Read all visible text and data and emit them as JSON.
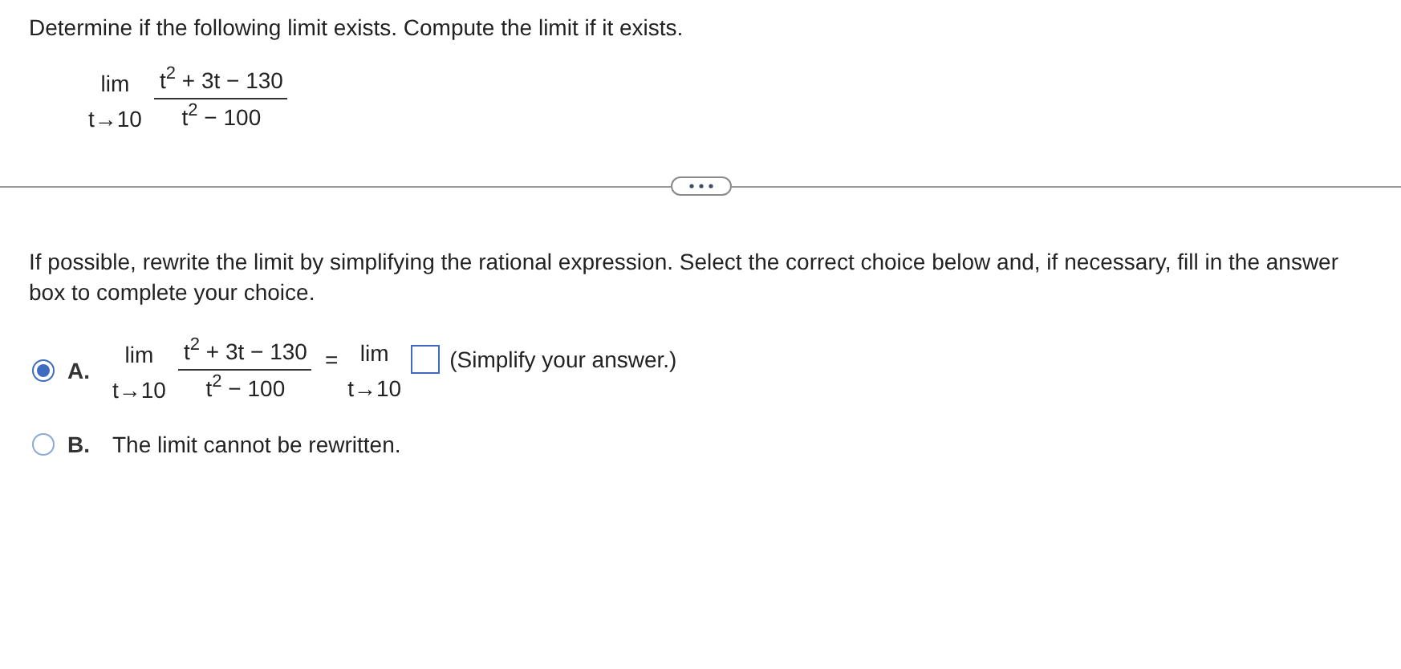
{
  "question": "Determine if the following limit exists. Compute the limit if it exists.",
  "limit": {
    "operator": "lim",
    "approach": "t→10",
    "numerator": "t$^{2}$ + 3t − 130",
    "denominator": "t$^{2}$ − 100"
  },
  "instruction": "If possible, rewrite the limit by simplifying the rational expression. Select the correct choice below and, if necessary, fill in the answer box to complete your choice.",
  "choices": [
    {
      "kind": "equation",
      "letter": "A.",
      "selected": true,
      "limit": {
        "operator": "lim",
        "approach": "t→10",
        "numerator": "t$^{2}$ + 3t − 130",
        "denominator": "t$^{2}$ − 100"
      },
      "equals": "=",
      "rhs": {
        "operator": "lim",
        "approach": "t→10"
      },
      "hint": "(Simplify your answer.)"
    },
    {
      "kind": "text",
      "letter": "B.",
      "selected": false,
      "text": "The limit cannot be rewritten."
    }
  ]
}
